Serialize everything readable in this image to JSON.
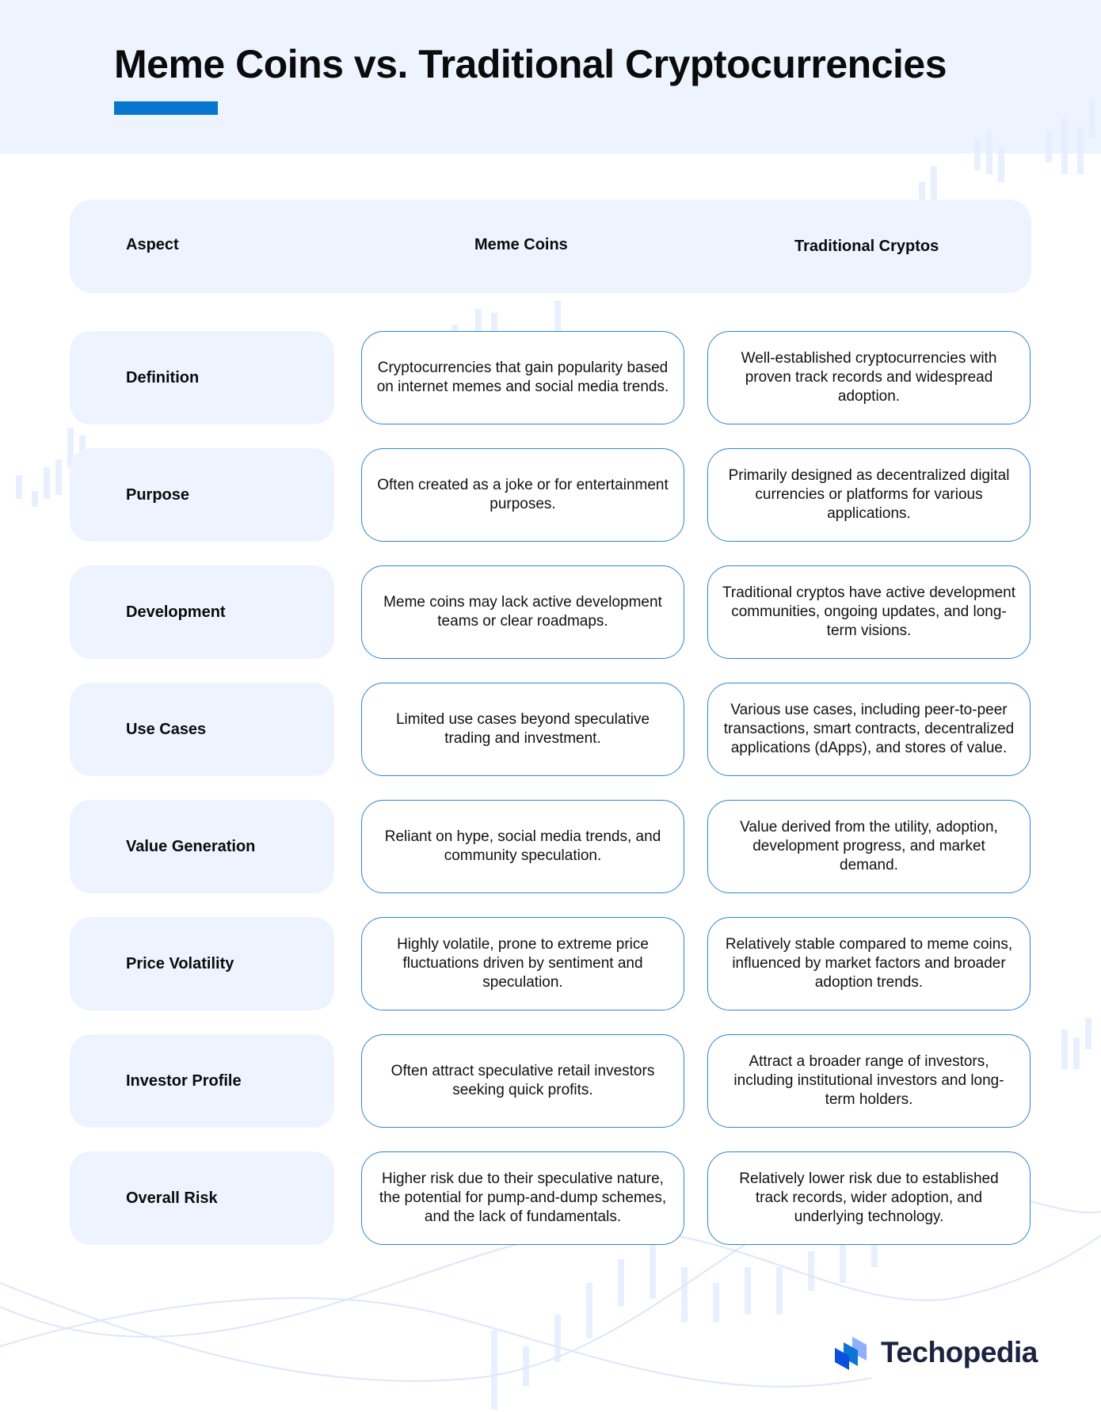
{
  "title": "Meme Coins vs. Traditional Cryptocurrencies",
  "colors": {
    "accent": "#0875cf",
    "header_bg": "#eef4ff",
    "cell_border": "#2f86d6",
    "logo_text": "#1b2340"
  },
  "table": {
    "headers": {
      "aspect": "Aspect",
      "meme": "Meme Coins",
      "traditional": "Traditional Cryptos"
    },
    "rows": [
      {
        "aspect": "Definition",
        "meme": "Cryptocurrencies that gain popularity based on internet memes and social media trends.",
        "traditional": "Well-established cryptocurrencies with proven track records and widespread adoption."
      },
      {
        "aspect": "Purpose",
        "meme": "Often created as a joke or for entertainment purposes.",
        "traditional": "Primarily designed as decentralized digital currencies or platforms for various applications."
      },
      {
        "aspect": "Development",
        "meme": "Meme coins may lack active development teams or clear roadmaps.",
        "traditional": "Traditional cryptos have active development communities, ongoing updates, and long-term visions."
      },
      {
        "aspect": "Use Cases",
        "meme": "Limited use cases beyond speculative trading and investment.",
        "traditional": "Various use cases, including peer-to-peer transactions, smart contracts, decentralized applications (dApps), and stores of value."
      },
      {
        "aspect": "Value Generation",
        "meme": "Reliant on hype, social media trends, and community speculation.",
        "traditional": "Value derived from the utility, adoption, development progress, and market demand."
      },
      {
        "aspect": "Price Volatility",
        "meme": "Highly volatile, prone to extreme price fluctuations driven by sentiment and speculation.",
        "traditional": "Relatively stable compared to meme coins, influenced by market factors and broader adoption trends."
      },
      {
        "aspect": "Investor Profile",
        "meme": "Often attract speculative retail investors seeking quick profits.",
        "traditional": "Attract a broader range of investors, including institutional investors and long-term holders."
      },
      {
        "aspect": "Overall Risk",
        "meme": "Higher risk due to their speculative nature, the potential for pump-and-dump schemes, and the lack of fundamentals.",
        "traditional": "Relatively lower risk due to established track records, wider adoption, and underlying technology."
      }
    ]
  },
  "logo": {
    "name": "Techopedia",
    "icon": "techopedia-logo-icon"
  }
}
